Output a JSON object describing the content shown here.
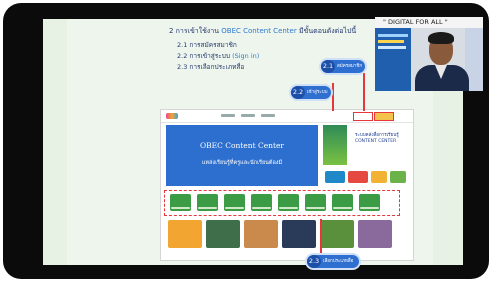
{
  "slide": {
    "heading_prefix": "2 การเข้าใช้งาน",
    "heading_highlight": "OBEC Content Center",
    "heading_suffix": "มีขั้นตอนดังต่อไปนี้",
    "steps": [
      {
        "text": "2.1 การสมัครสมาชิก",
        "highlight": ""
      },
      {
        "text": "2.2 การเข้าสู่ระบบ",
        "highlight": "(Sign in)"
      },
      {
        "text": "2.3 การเลือกประเภทสื่อ",
        "highlight": ""
      }
    ]
  },
  "website": {
    "hero_title": "OBEC Content Center",
    "hero_subtitle": "แหล่งเรียนรู้ที่ครูและนักเรียนต้องมี",
    "promo_text": [
      "ระบบคลังสื่อการเรียนรู้",
      "CONTENT CENTER"
    ]
  },
  "callouts": {
    "c21_num": "2.1",
    "c21_label": "สมัครสมาชิก",
    "c22_num": "2.2",
    "c22_label": "เข้าสู่ระบบ",
    "c23_num": "2.3",
    "c23_label": "เลือกประเภทสื่อ"
  },
  "webcam": {
    "banner": "\" DIGITAL FOR ALL \""
  },
  "colors": {
    "accent_blue": "#2f6fd0",
    "highlight_red": "#e8373c",
    "tile_green": "#3c9c46"
  }
}
